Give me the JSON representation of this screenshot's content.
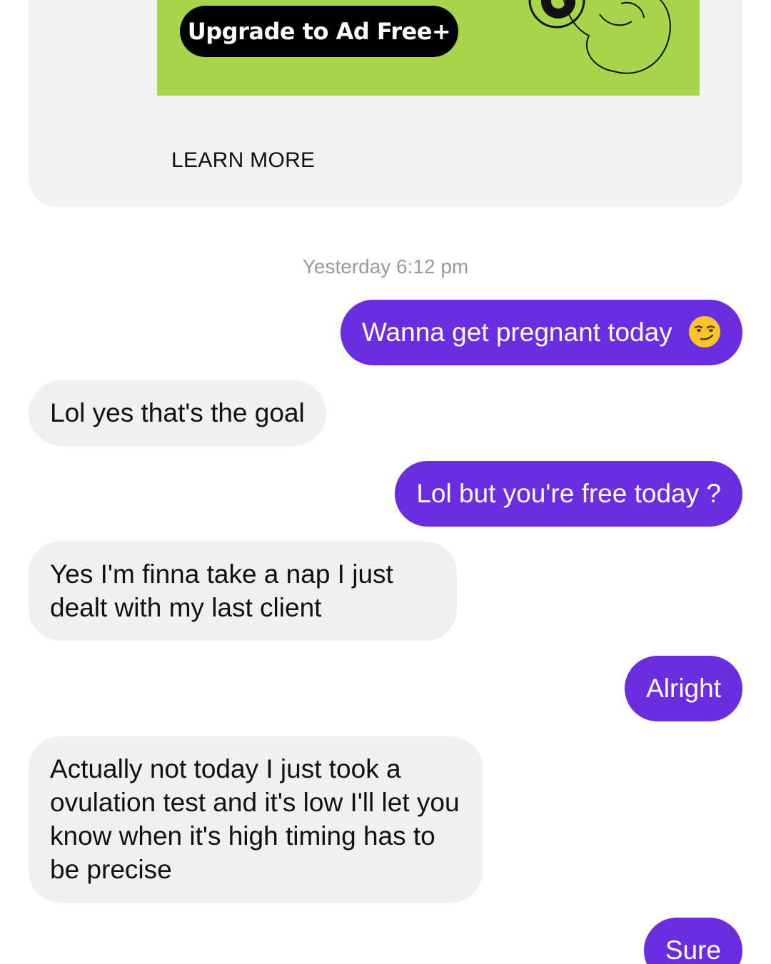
{
  "ad": {
    "upgrade_label": "Upgrade to Ad Free+",
    "learn_more_label": "LEARN MORE",
    "banner_color": "#a6d64a"
  },
  "conversation": {
    "timestamp": "Yesterday 6:12 pm",
    "messages": [
      {
        "direction": "sent",
        "text": "Wanna get pregnant today",
        "emoji": "smirking-face"
      },
      {
        "direction": "received",
        "text": "Lol yes that's the goal"
      },
      {
        "direction": "sent",
        "text": "Lol but you're free today ?"
      },
      {
        "direction": "received",
        "text": "Yes I'm finna take a nap I just dealt with my last client"
      },
      {
        "direction": "sent",
        "text": "Alright"
      },
      {
        "direction": "received",
        "text": "Actually not today I just took a ovulation test and it's low I'll let you know when it's high timing has to be precise"
      },
      {
        "direction": "sent",
        "text": "Sure"
      }
    ],
    "sent_color": "#6a2ee0",
    "received_color": "#f0f0f0"
  }
}
